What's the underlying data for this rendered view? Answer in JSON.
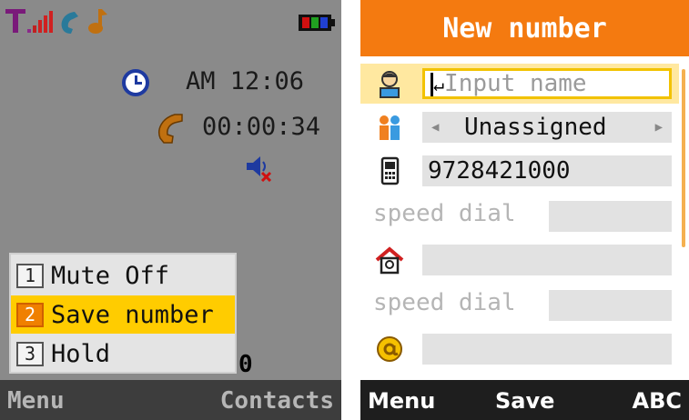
{
  "left_screen": {
    "status_icons": [
      "antenna-icon",
      "signal-bars-icon",
      "phone-call-icon",
      "music-note-icon",
      "battery-icon"
    ],
    "clock": {
      "icon": "clock-icon",
      "text": "AM 12:06"
    },
    "call_timer": {
      "icon": "handset-icon",
      "text": "00:00:34"
    },
    "speaker_icon": "speaker-muted-icon",
    "call_menu": [
      {
        "number": "1",
        "label": "Mute Off",
        "selected": false
      },
      {
        "number": "2",
        "label": "Save number",
        "selected": true
      },
      {
        "number": "3",
        "label": "Hold",
        "selected": false
      }
    ],
    "stray_digit": "0",
    "softkeys": {
      "left": "Menu",
      "right": "Contacts"
    }
  },
  "right_screen": {
    "title": "New number",
    "name_field": {
      "icon": "person-icon",
      "placeholder": "Input name"
    },
    "group_field": {
      "icon": "group-icon",
      "value": "Unassigned"
    },
    "phone_field": {
      "icon": "mobile-phone-icon",
      "value": "9728421000"
    },
    "speed_dial_label_1": "speed dial",
    "home_field": {
      "icon": "home-icon",
      "value": ""
    },
    "speed_dial_label_2": "speed dial",
    "email_field": {
      "icon": "email-at-icon",
      "value": ""
    },
    "softkeys": {
      "left": "Menu",
      "center": "Save",
      "right": "ABC"
    }
  },
  "colors": {
    "header_orange": "#f47a10",
    "highlight_yellow": "#ffcc00",
    "left_background": "#8a8a8a"
  }
}
